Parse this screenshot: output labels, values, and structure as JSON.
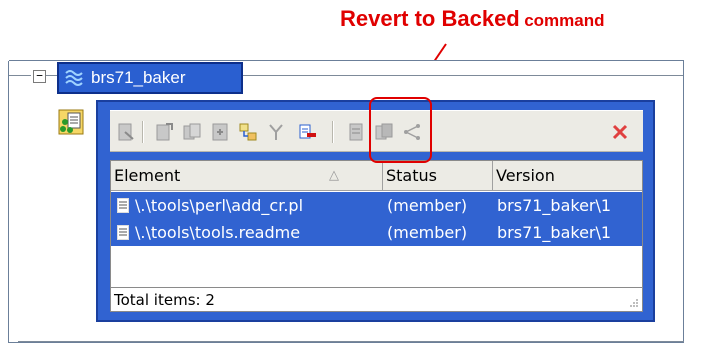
{
  "callout": {
    "text_big": "Revert to Backed",
    "text_small": "command",
    "color": "#e00000"
  },
  "tree": {
    "expander": "−",
    "node_label": "brs71_baker",
    "node_icon": "stream-icon",
    "side_icon": "view-icon"
  },
  "toolbar": {
    "buttons": [
      "checkout-icon",
      "add-to-source-icon",
      "checkin-icon",
      "undo-checkout-icon",
      "hijack-icon",
      "merge-icon",
      "revert-to-backed-icon",
      "properties-icon",
      "compare-icon",
      "version-tree-icon",
      "close-icon"
    ]
  },
  "grid": {
    "columns": [
      "Element",
      "Status",
      "Version"
    ],
    "sort_indicator": "△",
    "rows": [
      {
        "element": "\\.\\tools\\perl\\add_cr.pl",
        "status": "(member)",
        "version": "brs71_baker\\1"
      },
      {
        "element": "\\.\\tools\\tools.readme",
        "status": "(member)",
        "version": "brs71_baker\\1"
      }
    ],
    "total": "Total items: 2"
  },
  "colors": {
    "selection": "#3163d1",
    "toolbar_bg": "#ecebe5"
  }
}
